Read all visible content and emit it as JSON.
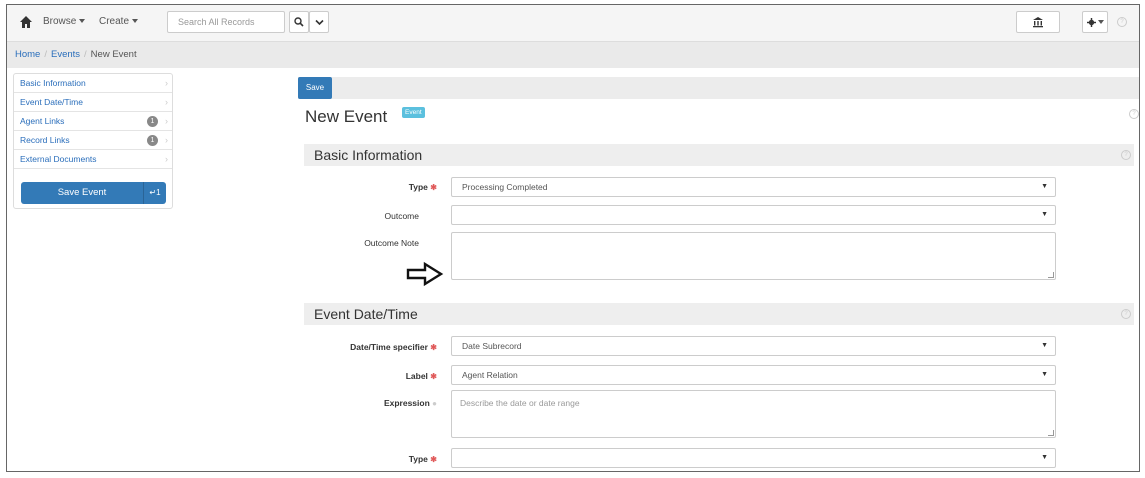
{
  "navbar": {
    "browse_label": "Browse",
    "create_label": "Create",
    "search_placeholder": "Search All Records"
  },
  "breadcrumb": {
    "home": "Home",
    "events": "Events",
    "current": "New Event"
  },
  "sidebar": {
    "items": [
      {
        "label": "Basic Information",
        "badge": ""
      },
      {
        "label": "Event Date/Time",
        "badge": ""
      },
      {
        "label": "Agent Links",
        "badge": "1"
      },
      {
        "label": "Record Links",
        "badge": "1"
      },
      {
        "label": "External Documents",
        "badge": ""
      }
    ],
    "save_label": "Save Event",
    "save_shortcut": "↵1"
  },
  "toolbar": {
    "save_label": "Save"
  },
  "page": {
    "title": "New Event",
    "badge": "Event"
  },
  "basic_information": {
    "heading": "Basic Information",
    "type_label": "Type",
    "type_value": "Processing Completed",
    "outcome_label": "Outcome",
    "outcome_value": "",
    "outcome_note_label": "Outcome Note"
  },
  "event_datetime": {
    "heading": "Event Date/Time",
    "specifier_label": "Date/Time specifier",
    "specifier_value": "Date Subrecord",
    "label_label": "Label",
    "label_value": "Agent Relation",
    "expression_label": "Expression",
    "expression_placeholder": "Describe the date or date range",
    "type_label": "Type",
    "type_value": ""
  },
  "colors": {
    "primary": "#337ab7",
    "info_badge": "#5bc0de",
    "required": "#e05a5a",
    "link": "#2a6ebb"
  }
}
